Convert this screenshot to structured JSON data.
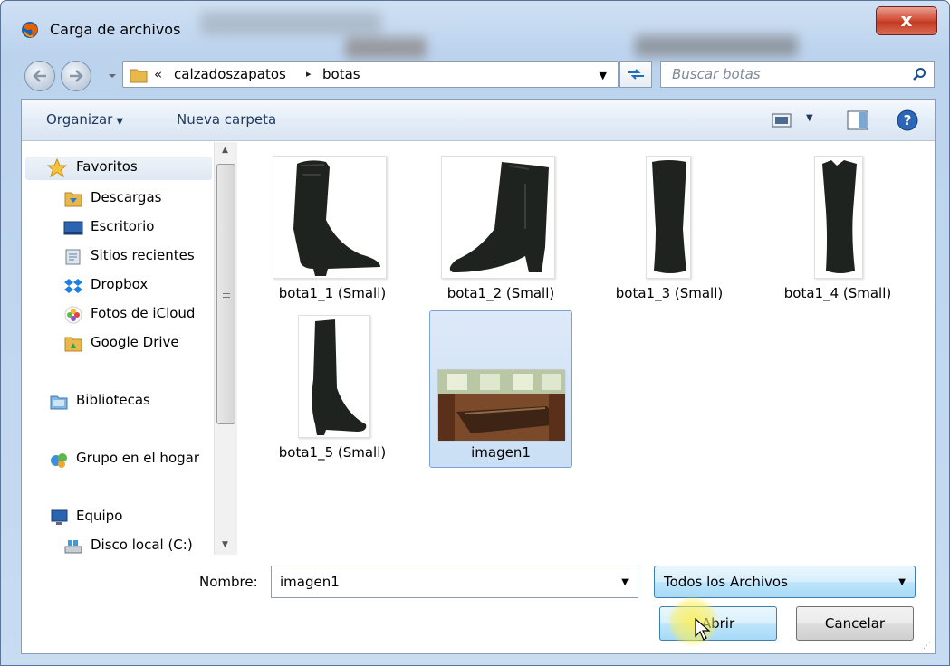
{
  "window": {
    "title": "Carga de archivos",
    "close_label": "x"
  },
  "address": {
    "chevrons": "«",
    "crumbs": [
      "calzadoszapatos",
      "botas"
    ],
    "separator": "▸",
    "search_placeholder": "Buscar botas"
  },
  "toolbar": {
    "organize_label": "Organizar",
    "new_folder_label": "Nueva carpeta"
  },
  "sidebar": {
    "items": [
      {
        "label": "Favoritos",
        "icon": "star-icon"
      },
      {
        "label": "Descargas",
        "icon": "downloads-folder-icon"
      },
      {
        "label": "Escritorio",
        "icon": "desktop-icon"
      },
      {
        "label": "Sitios recientes",
        "icon": "recent-places-icon"
      },
      {
        "label": "Dropbox",
        "icon": "dropbox-icon"
      },
      {
        "label": "Fotos de iCloud",
        "icon": "icloud-photos-icon"
      },
      {
        "label": "Google Drive",
        "icon": "google-drive-icon"
      },
      {
        "label": "Bibliotecas",
        "icon": "libraries-icon"
      },
      {
        "label": "Grupo en el hogar",
        "icon": "homegroup-icon"
      },
      {
        "label": "Equipo",
        "icon": "computer-icon"
      },
      {
        "label": "Disco local (C:)",
        "icon": "local-disk-icon"
      }
    ]
  },
  "files": [
    {
      "name": "bota1_1 (Small)",
      "kind": "boot-side"
    },
    {
      "name": "bota1_2 (Small)",
      "kind": "boot-side"
    },
    {
      "name": "bota1_3 (Small)",
      "kind": "boot-front"
    },
    {
      "name": "bota1_4 (Small)",
      "kind": "boot-front"
    },
    {
      "name": "bota1_5 (Small)",
      "kind": "boot-tall"
    },
    {
      "name": "imagen1",
      "kind": "room-photo",
      "selected": true
    }
  ],
  "bottom": {
    "name_label": "Nombre:",
    "name_value": "imagen1",
    "filter_value": "Todos los Archivos",
    "open_label": "Abrir",
    "cancel_label": "Cancelar"
  },
  "colors": {
    "accent": "#3c7fb1",
    "selection": "#cadff5",
    "close": "#c23a22"
  }
}
